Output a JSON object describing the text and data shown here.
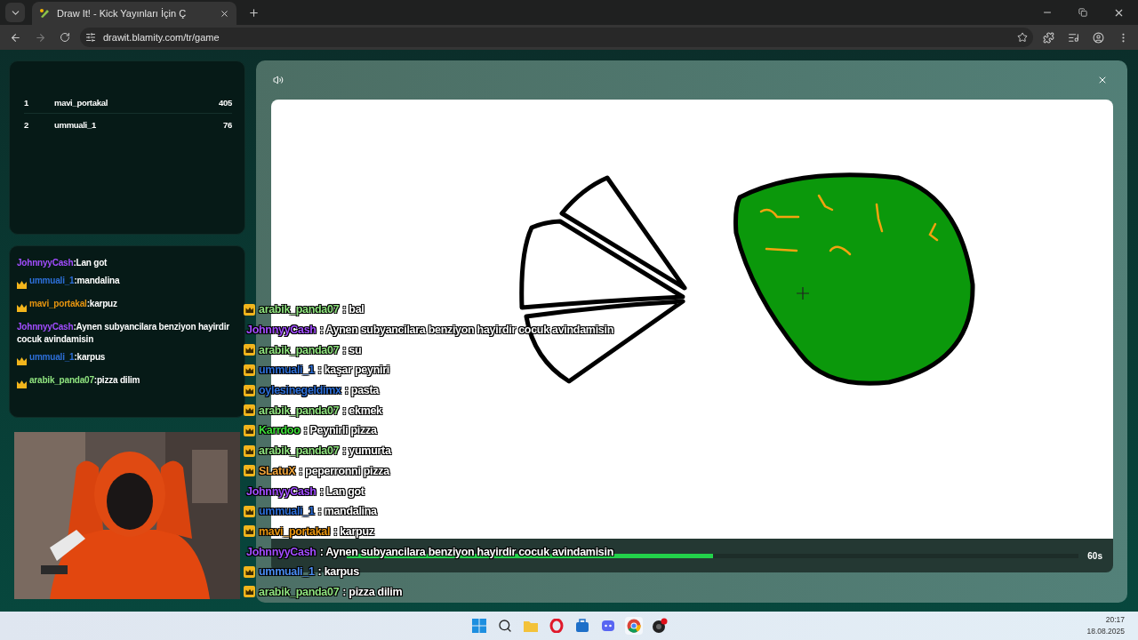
{
  "browser": {
    "tab_title": "Draw It! - Kick Yayınları İçin Ç",
    "url": "drawit.blamity.com/tr/game"
  },
  "leaderboard": [
    {
      "rank": "1",
      "name": "mavi_portakal",
      "score": "405"
    },
    {
      "rank": "2",
      "name": "ummuali_1",
      "score": "76"
    }
  ],
  "chat": [
    {
      "user": "JohnnyyCash",
      "color": "#a24dff",
      "badge": false,
      "text": ":Lan got"
    },
    {
      "user": "ummuali_1",
      "color": "#2d6fd8",
      "badge": true,
      "text": ":mandalina"
    },
    {
      "user": "mavi_portakal",
      "color": "#e8950f",
      "badge": true,
      "text": ":karpuz"
    },
    {
      "user": "JohnnyyCash",
      "color": "#a24dff",
      "badge": false,
      "text": ":Aynen subyancilara benziyon hayirdir cocuk avindamisin"
    },
    {
      "user": "ummuali_1",
      "color": "#2d6fd8",
      "badge": true,
      "text": ":karpus"
    },
    {
      "user": "arabik_panda07",
      "color": "#8fe37f",
      "badge": true,
      "text": ":pizza dilim"
    }
  ],
  "overlay_chat": [
    {
      "user": "arabik_panda07",
      "color": "#8fe37f",
      "badge": true,
      "text": ": bal"
    },
    {
      "user": "JohnnyyCash",
      "color": "#a24dff",
      "badge": false,
      "text": ": Aynen subyancilara benziyon hayirdir cocuk avindamisin"
    },
    {
      "user": "arabik_panda07",
      "color": "#8fe37f",
      "badge": true,
      "text": ": su"
    },
    {
      "user": "ummuali_1",
      "color": "#2d6fd8",
      "badge": true,
      "text": ": kaşar peyniri"
    },
    {
      "user": "oylesinegeldimx",
      "color": "#2d6fd8",
      "badge": true,
      "text": ": pasta"
    },
    {
      "user": "arabik_panda07",
      "color": "#8fe37f",
      "badge": true,
      "text": ": ekmek"
    },
    {
      "user": "Karrdoo",
      "color": "#3fe03a",
      "badge": true,
      "text": ": Peynirli pizza"
    },
    {
      "user": "arabik_panda07",
      "color": "#8fe37f",
      "badge": true,
      "text": ": yumurta"
    },
    {
      "user": "SLatuX",
      "color": "#f0a43a",
      "badge": true,
      "text": ": peperronni pizza"
    },
    {
      "user": "JohnnyyCash",
      "color": "#a24dff",
      "badge": false,
      "text": ": Lan got"
    },
    {
      "user": "ummuali_1",
      "color": "#2d6fd8",
      "badge": true,
      "text": ": mandalina"
    },
    {
      "user": "mavi_portakal",
      "color": "#e8950f",
      "badge": true,
      "text": ": karpuz"
    },
    {
      "user": "JohnnyyCash",
      "color": "#a24dff",
      "badge": false,
      "text": ": Aynen subyancilara benziyon hayirdir cocuk avindamisin"
    },
    {
      "user": "ummuali_1",
      "color": "#4a8cf2",
      "badge": true,
      "text": ": karpus"
    },
    {
      "user": "arabik_panda07",
      "color": "#8fe37f",
      "badge": true,
      "text": ": pizza dilim"
    }
  ],
  "game": {
    "timer": {
      "level": 0.5,
      "reading": "60s"
    }
  },
  "taskbar": {
    "time": "20:17",
    "date": "18.08.2025"
  }
}
